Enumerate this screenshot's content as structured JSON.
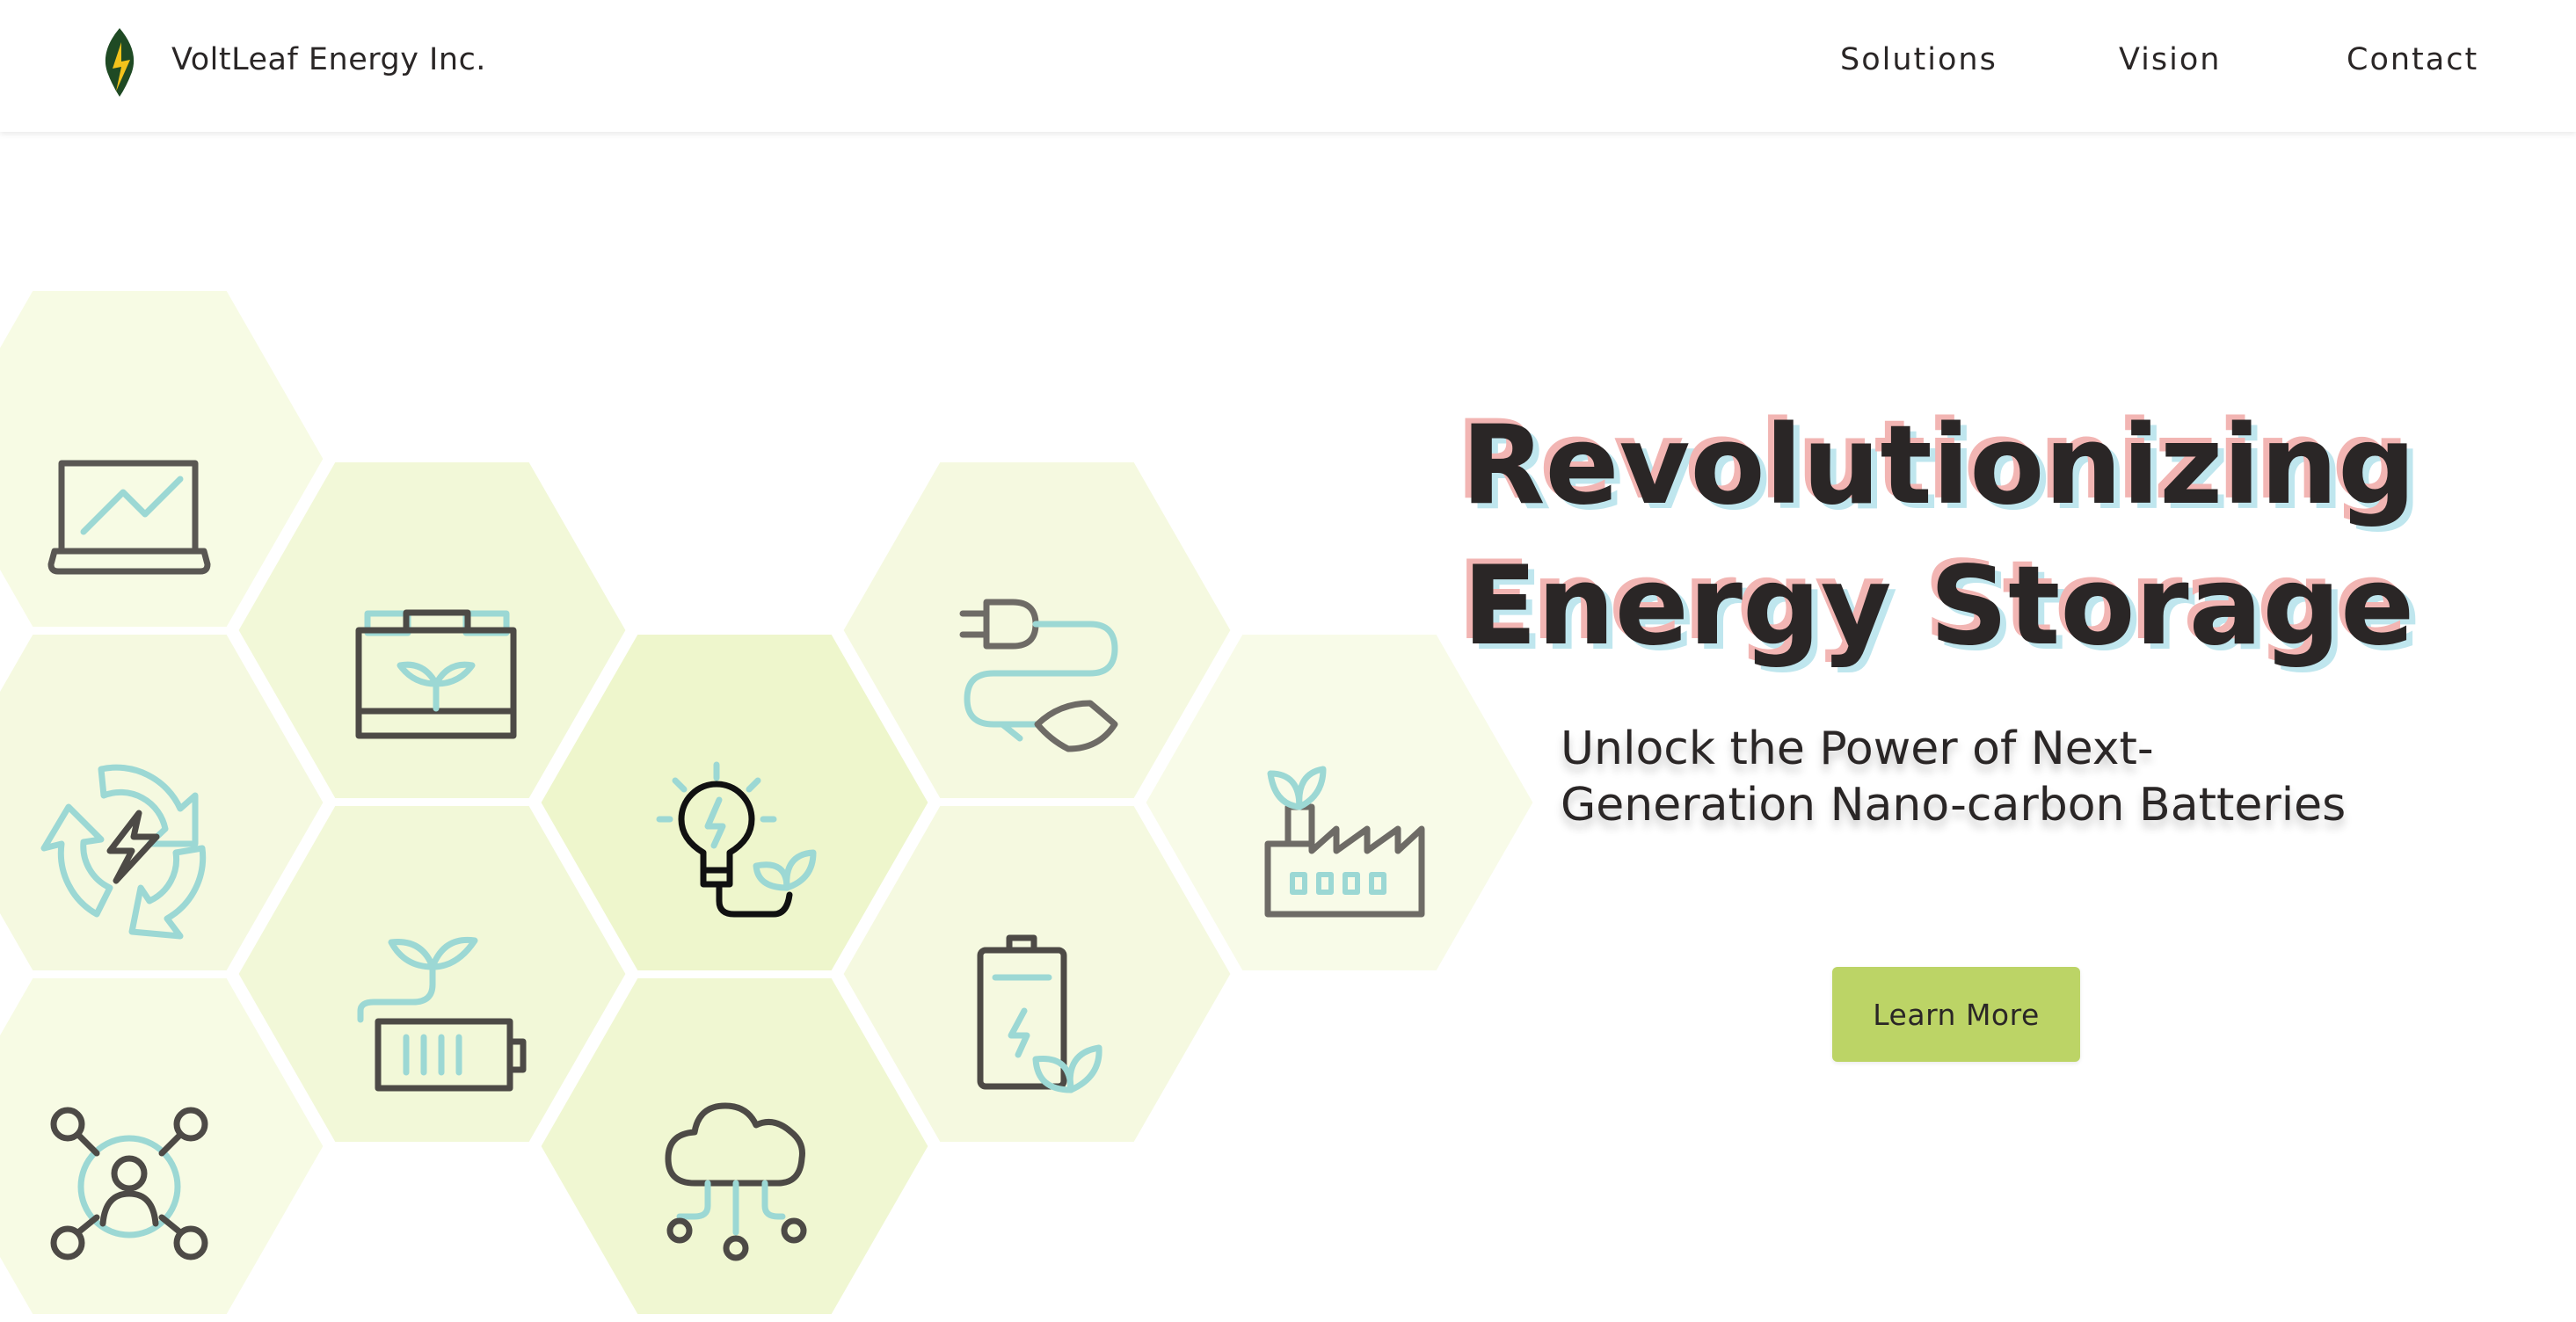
{
  "header": {
    "brand": "VoltLeaf Energy Inc.",
    "logo_icon": "leaf-bolt-logo-icon",
    "nav": [
      {
        "label": "Solutions"
      },
      {
        "label": "Vision"
      },
      {
        "label": "Contact"
      }
    ]
  },
  "hero": {
    "title_line1": "Revolutionizing",
    "title_line2": "Energy Storage",
    "subtitle_line1": "Unlock the Power of Next-",
    "subtitle_line2": "Generation Nano-carbon Batteries",
    "cta_label": "Learn More"
  },
  "hex_icons": [
    "laptop-chart-icon",
    "battery-sprout-icon",
    "recycle-bolt-icon",
    "battery-plant-icon",
    "network-user-icon",
    "lightbulb-leaf-icon",
    "cloud-network-icon",
    "plug-leaf-icon",
    "battery-leaf-icon",
    "eco-factory-icon"
  ],
  "colors": {
    "text": "#2a2626",
    "button": "#bcd466",
    "hex_light": "#f7fbe4",
    "hex_mid": "#f2f8d8",
    "hex_strong": "#eef6cc",
    "icon_dark": "#4d4a46",
    "icon_teal": "#9cd8d4",
    "title_shadow_pink": "#f2b5b3",
    "title_shadow_blue": "#bfe6ee"
  }
}
